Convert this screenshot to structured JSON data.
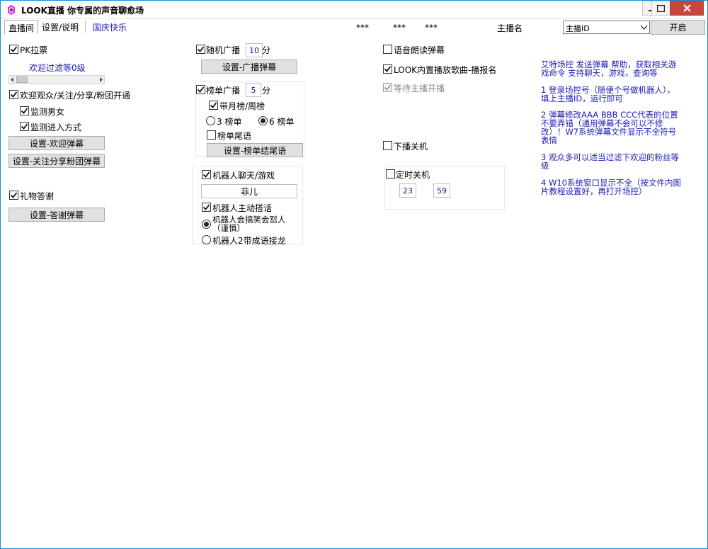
{
  "window": {
    "title": "LOOK直播 你专属的声音聊愈场",
    "controls": {
      "minimize": "minimize",
      "maximize": "maximize",
      "close": "close"
    }
  },
  "tabs": [
    {
      "label": "直播间",
      "active": true
    },
    {
      "label": "设置/说明",
      "active": false
    },
    {
      "label": "国庆快乐",
      "active": false
    }
  ],
  "header": {
    "stars1": "***",
    "stars2": "***",
    "stars3": "***",
    "anchor_label": "主播名",
    "anchor_select": "主播ID",
    "start_button": "开启"
  },
  "col1": {
    "pk": {
      "label": "PK拉票",
      "checked": true
    },
    "welcome_filter": "欢迎过滤等0级",
    "welcome_group": {
      "label": "欢迎观众/关注/分享/粉团开通",
      "checked": true
    },
    "detect_gender": {
      "label": "监测男女",
      "checked": true
    },
    "detect_entry": {
      "label": "监测进入方式",
      "checked": true
    },
    "set_welcome_btn": "设置-欢迎弹幕",
    "set_follow_btn": "设置-关注分享粉团弹幕",
    "gift_thanks": {
      "label": "礼物答谢",
      "checked": true
    },
    "set_thanks_btn": "设置-答谢弹幕"
  },
  "col2": {
    "random_broadcast": {
      "label": "随机广播",
      "checked": true,
      "value": "10",
      "unit": "分"
    },
    "set_broadcast_btn": "设置-广播弹幕",
    "rank_broadcast": {
      "label": "榜单广播",
      "checked": true,
      "value": "5",
      "unit": "分"
    },
    "with_month_week": {
      "label": "带月榜/周榜",
      "checked": true
    },
    "rank3": {
      "label": "3 榜单",
      "selected": false
    },
    "rank6": {
      "label": "6 榜单",
      "selected": true
    },
    "rank_tail": {
      "label": "榜单尾语",
      "checked": false
    },
    "set_rank_tail_btn": "设置-榜单结尾语",
    "robot_chat": {
      "label": "机器人聊天/游戏",
      "checked": true
    },
    "robot_name": "菲儿",
    "robot_active": {
      "label": "机器人主动搭话",
      "checked": true
    },
    "robot_mode1": {
      "label": "机器人会搞笑会怼人（谨慎）",
      "selected": true
    },
    "robot_mode2": {
      "label": "机器人2带成语接龙",
      "selected": false
    }
  },
  "col3": {
    "voice_read": {
      "label": "语音朗读弹幕",
      "checked": false
    },
    "look_music": {
      "label": "LOOK内置播放歌曲-播报名",
      "checked": true
    },
    "wait_anchor": {
      "label": "等待主播开播",
      "checked": true
    },
    "shutdown_offline": {
      "label": "下播关机",
      "checked": false
    },
    "timed_shutdown": {
      "label": "定时关机",
      "checked": false,
      "hour": "23",
      "minute": "59"
    }
  },
  "info": {
    "p0": "艾特场控 发送弹幕 帮助，获取相关游戏命令 支持聊天，游戏，查询等",
    "p1": "1 登录场控号（随便个号做机器人），填上主播ID，运行即可",
    "p2": "2 弹幕修改AAA BBB CCC代表的位置不要弄错（通用弹幕不会可以不修改）！W7系统弹幕文件显示不全符号表情",
    "p3": "3 观众多可以适当过滤下欢迎的粉丝等级",
    "p4": "4 W10系统窗口显示不全（按文件内图片教程设置好，再打开场控）"
  },
  "colors": {
    "accent": "#1b1bb3",
    "close": "#c9463d",
    "border": "#1e8fd6"
  }
}
